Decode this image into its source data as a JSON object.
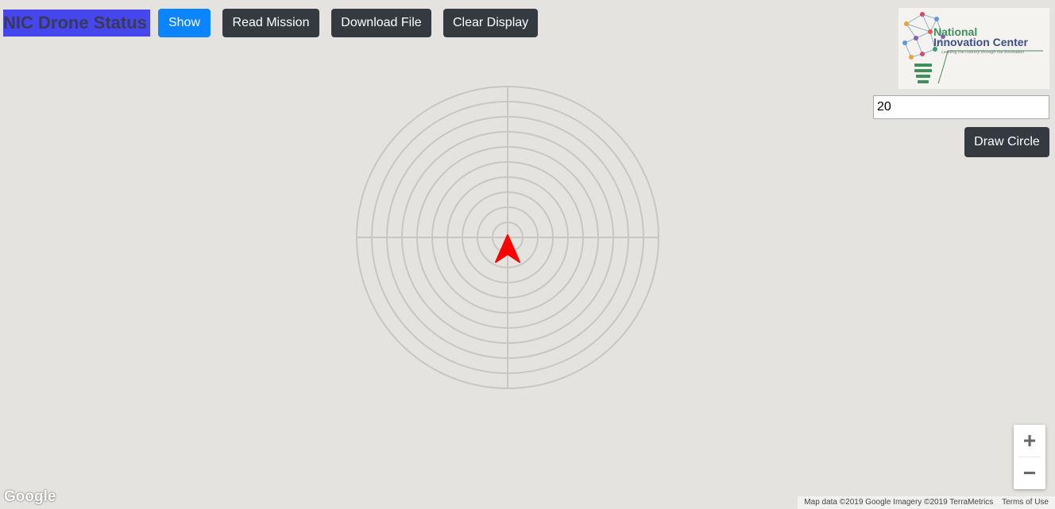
{
  "header": {
    "title": "NIC Drone Status",
    "show_label": "Show",
    "read_mission_label": "Read Mission",
    "download_file_label": "Download File",
    "clear_display_label": "Clear Display"
  },
  "logo": {
    "line1": "National",
    "line2": "Innovation Center",
    "tagline": "Leading the country through the innovation"
  },
  "controls": {
    "radius_value": "20",
    "draw_circle_label": "Draw Circle"
  },
  "map": {
    "rings": 9,
    "drone_marker_color": "#ff0000",
    "ring_color": "#c8c6c2",
    "zoom_in_label": "+",
    "zoom_out_label": "−",
    "google_logo": "Google",
    "map_data_text": "Map data ©2019 Google Imagery ©2019 TerraMetrics",
    "terms_text": "Terms of Use"
  },
  "colors": {
    "primary_button": "#0a84ff",
    "dark_button": "#343a40",
    "title_background": "#4646ee",
    "map_background": "#e5e3df"
  }
}
